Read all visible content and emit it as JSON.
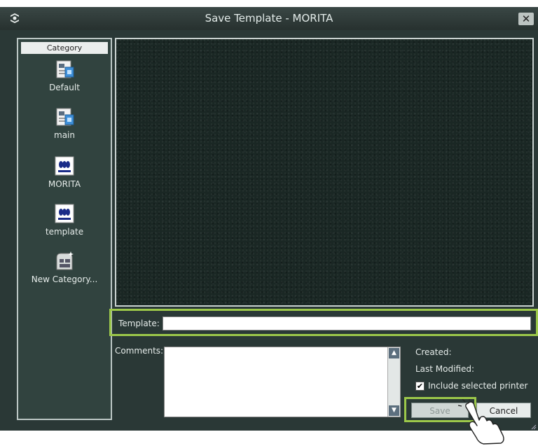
{
  "window": {
    "title": "Save Template - MORITA",
    "app_icon": "app-logo-icon",
    "close_icon": "close-icon",
    "close_glyph": "✕"
  },
  "sidebar": {
    "header": "Category",
    "items": [
      {
        "label": "Default",
        "icon": "template-doc-icon"
      },
      {
        "label": "main",
        "icon": "template-doc-icon"
      },
      {
        "label": "MORITA",
        "icon": "morita-logo-icon"
      },
      {
        "label": "template",
        "icon": "morita-logo-icon"
      },
      {
        "label": "New Category...",
        "icon": "new-category-icon"
      }
    ]
  },
  "form": {
    "template_label": "Template:",
    "template_value": "",
    "comments_label": "Comments:",
    "comments_value": "",
    "created_label": "Created:",
    "modified_label": "Last Modified:",
    "include_printer_label": "Include selected printer",
    "include_printer_checked": true,
    "checkbox_glyph": "✔",
    "scroll_up_glyph": "▲",
    "scroll_down_glyph": "▼"
  },
  "buttons": {
    "save": "Save",
    "cancel": "Cancel"
  },
  "colors": {
    "background": "#2a3836",
    "highlight": "#9cc84a"
  }
}
